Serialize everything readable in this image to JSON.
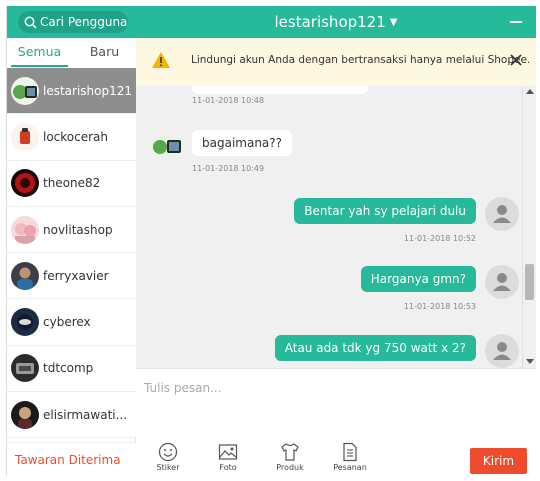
{
  "sidebar": {
    "search_placeholder": "Cari Pengguna",
    "tabs": [
      {
        "label": "Semua",
        "active": true
      },
      {
        "label": "Baru",
        "active": false
      }
    ],
    "contacts": [
      {
        "name": "lestarishop121",
        "selected": true
      },
      {
        "name": "lockocerah",
        "selected": false
      },
      {
        "name": "theone82",
        "selected": false
      },
      {
        "name": "novlitashop",
        "selected": false
      },
      {
        "name": "ferryxavier",
        "selected": false
      },
      {
        "name": "cyberex",
        "selected": false
      },
      {
        "name": "tdtcomp",
        "selected": false
      },
      {
        "name": "elisirmawati..."
      }
    ],
    "offers_label": "Tawaran Diterima"
  },
  "chat": {
    "title": "lestarishop121",
    "banner": "Lindungi akun Anda dengan bertransaksi hanya melalui Shopee.",
    "messages": [
      {
        "direction": "in",
        "text": "",
        "time": "11-01-2018 10:48"
      },
      {
        "direction": "in",
        "text": "bagaimana??",
        "time": "11-01-2018 10:49"
      },
      {
        "direction": "out",
        "text": "Bentar yah sy pelajari dulu",
        "time": "11-01-2018 10:52"
      },
      {
        "direction": "out",
        "text": "Harganya gmn?",
        "time": "11-01-2018 10:53"
      },
      {
        "direction": "out",
        "text": "Atau ada tdk yg 750 watt x 2?",
        "time": ""
      }
    ],
    "input_placeholder": "Tulis pesan...",
    "toolbar": {
      "stiker": "Stiker",
      "foto": "Foto",
      "produk": "Produk",
      "pesanan": "Pesanan",
      "send": "Kirim"
    }
  },
  "colors": {
    "primary": "#26b99a",
    "send": "#ee4d2d",
    "banner_bg": "#fff8e1",
    "chat_bg": "#f0f0f0"
  }
}
